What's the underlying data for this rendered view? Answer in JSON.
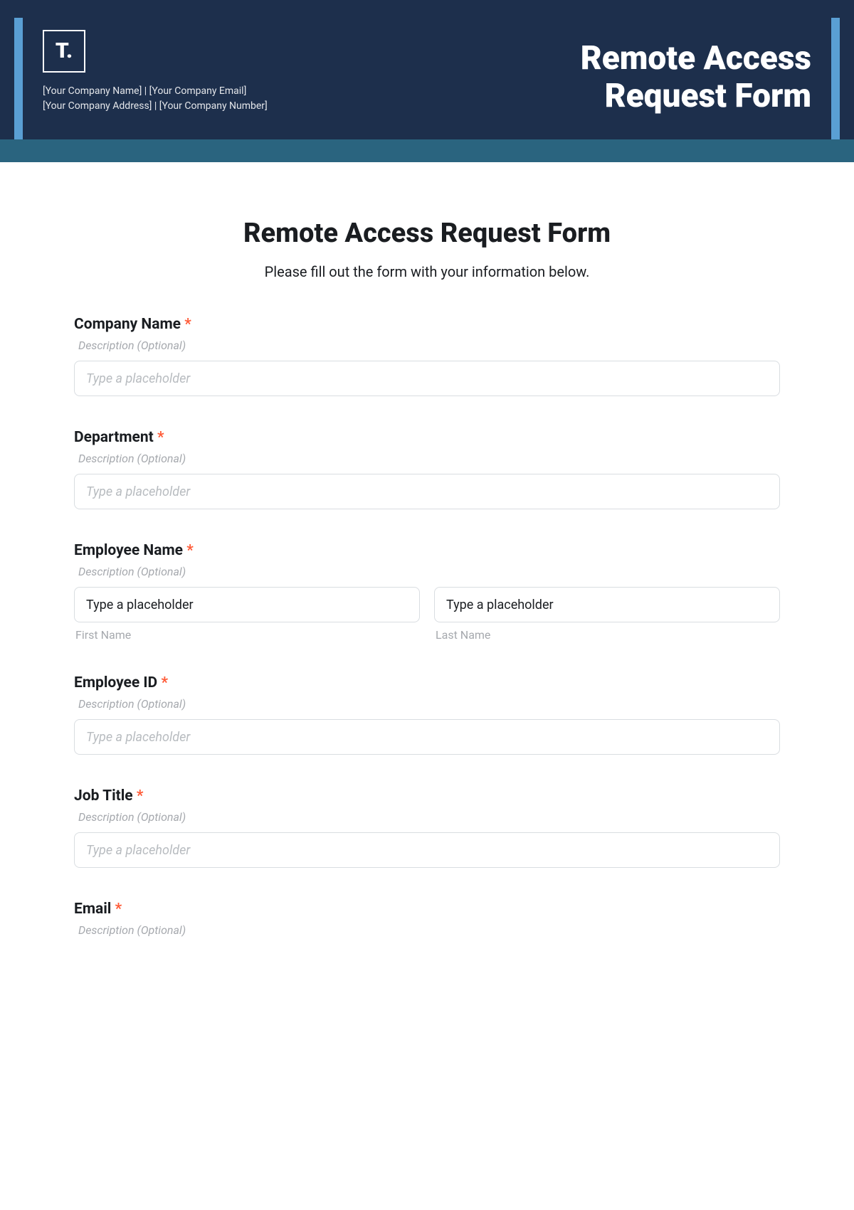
{
  "header": {
    "logo": "T.",
    "company_meta_line1": "[Your Company Name]  |  [Your Company Email]",
    "company_meta_line2": "[Your Company Address]  |  [Your Company Number]",
    "title_line1": "Remote Access",
    "title_line2": "Request Form"
  },
  "form": {
    "heading": "Remote Access Request Form",
    "subheading": "Please fill out the form with your information below.",
    "desc_optional": "Description (Optional)",
    "placeholder": "Type a placeholder",
    "fields": {
      "company_name": {
        "label": "Company Name",
        "required": "*"
      },
      "department": {
        "label": "Department",
        "required": "*"
      },
      "employee_name": {
        "label": "Employee Name",
        "required": "*",
        "first_value": "Type a placeholder",
        "last_value": "Type a placeholder",
        "first_sub": "First Name",
        "last_sub": "Last Name"
      },
      "employee_id": {
        "label": "Employee ID",
        "required": "*"
      },
      "job_title": {
        "label": "Job Title",
        "required": "*"
      },
      "email": {
        "label": "Email",
        "required": "*"
      }
    }
  }
}
